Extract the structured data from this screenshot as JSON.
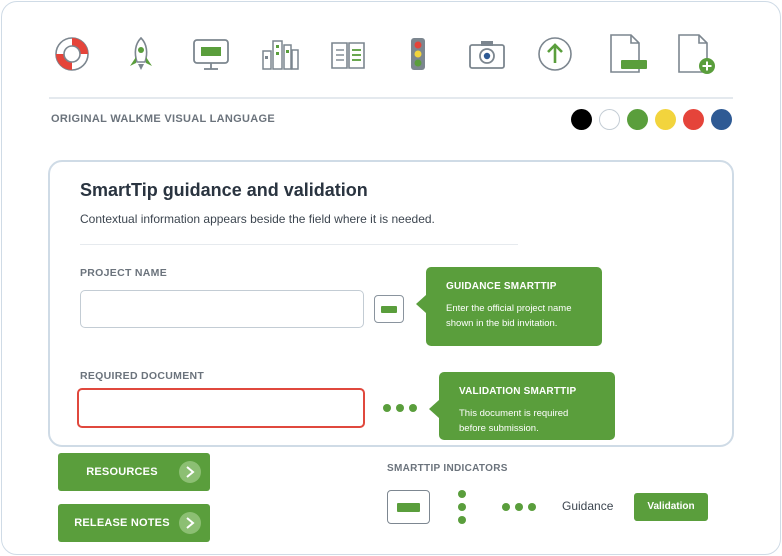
{
  "icons": [
    {
      "name": "lifebuoy-icon"
    },
    {
      "name": "rocket-icon"
    },
    {
      "name": "monitor-icon"
    },
    {
      "name": "buildings-icon"
    },
    {
      "name": "book-icon"
    },
    {
      "name": "traffic-light-icon"
    },
    {
      "name": "camera-icon"
    },
    {
      "name": "upload-circle-icon"
    },
    {
      "name": "document-icon"
    },
    {
      "name": "document-add-icon"
    }
  ],
  "visual_language": {
    "label": "ORIGINAL WALKME VISUAL LANGUAGE",
    "swatches": [
      "#000000",
      "#ffffff",
      "#5a9e3c",
      "#f2d43d",
      "#e5443a",
      "#2e5a94"
    ]
  },
  "card": {
    "title": "SmartTip guidance and validation",
    "subtitle": "Contextual information appears beside the field where it is needed.",
    "project_name_label": "PROJECT NAME",
    "project_name_value": "",
    "required_document_label": "REQUIRED DOCUMENT",
    "required_document_value": ""
  },
  "guidance_tip": {
    "title": "GUIDANCE SMARTTIP",
    "body_line1": "Enter the official project name",
    "body_line2": "shown in the bid invitation."
  },
  "validation_tip": {
    "title": "VALIDATION SMARTTIP",
    "body_line1": "This document is required",
    "body_line2": "before submission."
  },
  "buttons": {
    "resources": "RESOURCES",
    "release_notes": "RELEASE NOTES"
  },
  "indicators": {
    "label": "SMARTTIP INDICATORS",
    "guidance": "Guidance",
    "validation": "Validation"
  },
  "colors": {
    "accent_green": "#5a9e3c",
    "error_red": "#e0483d"
  }
}
